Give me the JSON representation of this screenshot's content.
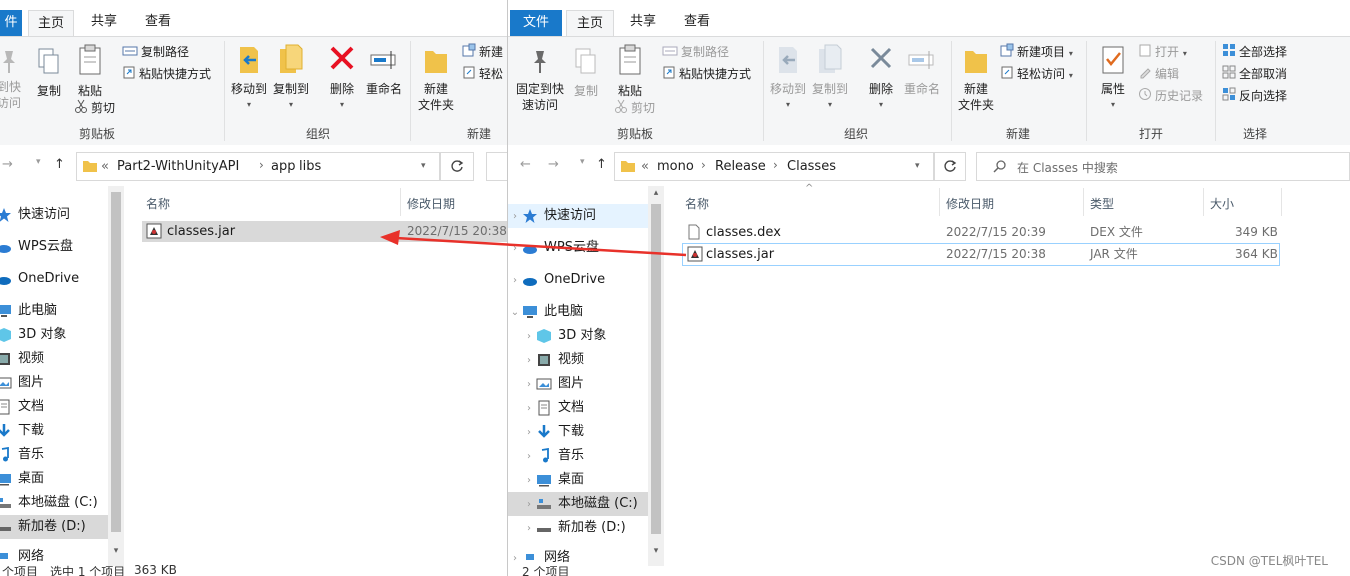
{
  "left": {
    "tabs": [
      "件",
      "主页",
      "共享",
      "查看"
    ],
    "ribbon": {
      "pin_label_1": "到快",
      "pin_label_2": "访问",
      "copy": "复制",
      "paste": "粘贴",
      "copy_path": "复制路径",
      "paste_shortcut": "粘贴快捷方式",
      "cut": "剪切",
      "clipboard_group": "剪贴板",
      "move_to": "移动到",
      "copy_to": "复制到",
      "delete": "删除",
      "rename": "重命名",
      "organize_group": "组织",
      "new_folder_1": "新建",
      "new_folder_2": "文件夹",
      "new_item": "新建",
      "easy_access": "轻松",
      "new_group": "新建"
    },
    "address": {
      "prefix": "«",
      "crumbs": [
        "Part2-WithUnityAPI",
        "app",
        "libs"
      ]
    },
    "nav": [
      "快速访问",
      "WPS云盘",
      "OneDrive",
      "此电脑",
      "3D 对象",
      "视频",
      "图片",
      "文档",
      "下载",
      "音乐",
      "桌面",
      "本地磁盘 (C:)",
      "新加卷 (D:)",
      "网络"
    ],
    "columns": {
      "name": "名称",
      "modified": "修改日期"
    },
    "files": [
      {
        "name": "classes.jar",
        "modified": "2022/7/15 20:38"
      }
    ],
    "status": {
      "count": "个项目",
      "selected": "选中 1 个项目",
      "size": "363 KB"
    }
  },
  "right": {
    "tabs": [
      "文件",
      "主页",
      "共享",
      "查看"
    ],
    "ribbon": {
      "pin_1": "固定到快",
      "pin_2": "速访问",
      "copy": "复制",
      "paste": "粘贴",
      "copy_path": "复制路径",
      "paste_shortcut": "粘贴快捷方式",
      "cut": "剪切",
      "clipboard_group": "剪贴板",
      "move_to": "移动到",
      "copy_to": "复制到",
      "delete": "删除",
      "rename": "重命名",
      "organize_group": "组织",
      "new_folder_1": "新建",
      "new_folder_2": "文件夹",
      "new_item": "新建项目",
      "easy_access": "轻松访问",
      "new_group": "新建",
      "properties": "属性",
      "open": "打开",
      "edit": "编辑",
      "history": "历史记录",
      "open_group": "打开",
      "select_all": "全部选择",
      "select_none": "全部取消",
      "invert": "反向选择",
      "select_group": "选择"
    },
    "address": {
      "prefix": "«",
      "crumbs": [
        "mono",
        "Release",
        "Classes"
      ],
      "search_placeholder": "在 Classes 中搜索"
    },
    "nav": [
      "快速访问",
      "WPS云盘",
      "OneDrive",
      "此电脑",
      "3D 对象",
      "视频",
      "图片",
      "文档",
      "下载",
      "音乐",
      "桌面",
      "本地磁盘 (C:)",
      "新加卷 (D:)",
      "网络"
    ],
    "columns": {
      "name": "名称",
      "modified": "修改日期",
      "type": "类型",
      "size": "大小"
    },
    "files": [
      {
        "name": "classes.dex",
        "modified": "2022/7/15 20:39",
        "type": "DEX 文件",
        "size": "349 KB"
      },
      {
        "name": "classes.jar",
        "modified": "2022/7/15 20:38",
        "type": "JAR 文件",
        "size": "364 KB"
      }
    ],
    "status": {
      "count": "2 个项目"
    }
  },
  "watermark": "CSDN @TEL枫叶TEL",
  "colors": {
    "accent": "#1979ca",
    "arrow": "#e8312a",
    "delete_red": "#e81123",
    "folder": "#f0c24a"
  }
}
